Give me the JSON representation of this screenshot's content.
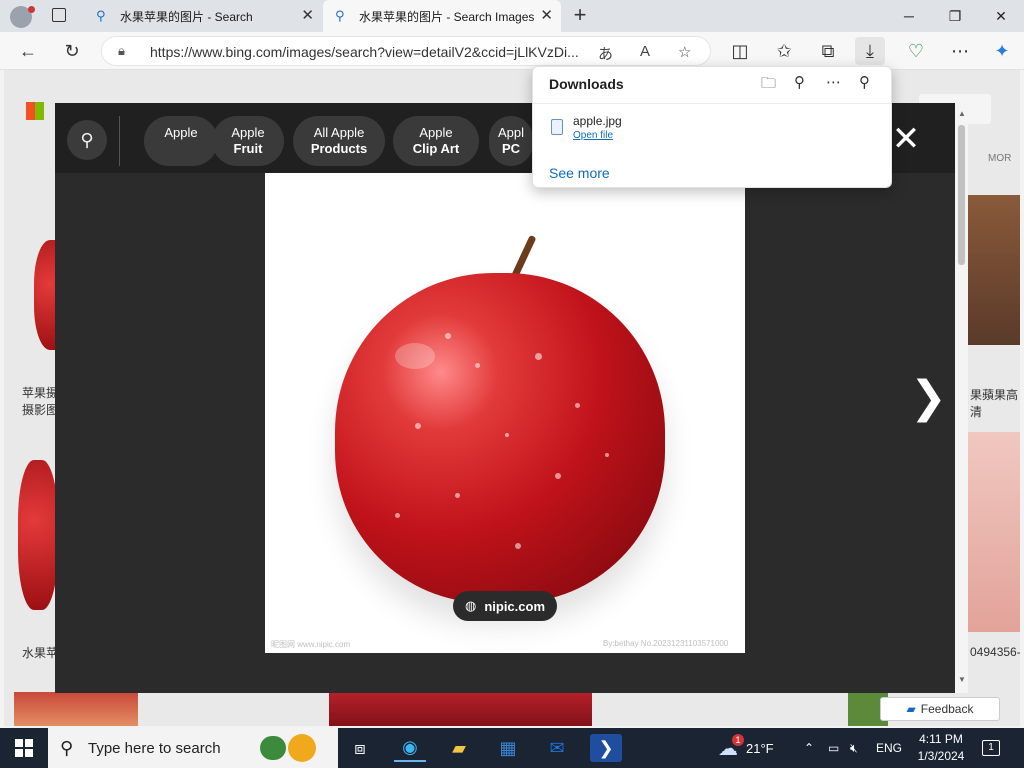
{
  "browser": {
    "tabs": [
      {
        "title": "水果苹果的图片 - Search"
      },
      {
        "title": "水果苹果的图片 - Search Images"
      }
    ],
    "new_tab_symbol": "+",
    "url": "https://www.bing.com/images/search?view=detailV2&ccid=jLlKVzDi...",
    "icons": [
      "tab-actions-icon",
      "back-icon",
      "refresh-icon",
      "lock-icon",
      "translate-icon",
      "read-aloud-icon",
      "favorite-icon",
      "split-screen-icon",
      "favorites-icon",
      "collections-icon",
      "downloads-icon",
      "browser-essentials-icon",
      "more-icon",
      "copilot-icon"
    ]
  },
  "overlay": {
    "chips": [
      {
        "line1": "Apple",
        "line2": ""
      },
      {
        "line1": "Apple",
        "line2": "Fruit"
      },
      {
        "line1": "All Apple",
        "line2": "Products"
      },
      {
        "line1": "Apple",
        "line2": "Clip Art"
      },
      {
        "line1": "Appl",
        "line2": "PC"
      }
    ],
    "source_label": "nipic.com",
    "watermark_left": "昵图网 www.nipic.com",
    "watermark_right": "By:bethay No.20231231103571000",
    "close_symbol": "✕",
    "next_symbol": "❯"
  },
  "background_page": {
    "left_caption_1": "苹果摄",
    "left_caption_2": "摄影图",
    "left_caption_3": "水果苹",
    "right_caption_1": "果蘋果高清",
    "right_caption_2": "0494356-",
    "more_label": "MOR"
  },
  "downloads": {
    "title": "Downloads",
    "file_name": "apple.jpg",
    "open_label": "Open file",
    "see_more": "See more"
  },
  "feedback_label": "Feedback",
  "taskbar": {
    "search_placeholder": "Type here to search",
    "weather_temp": "21°F",
    "weather_badge": "1",
    "language": "ENG",
    "time": "4:11 PM",
    "date": "1/3/2024",
    "notification_count": "1"
  },
  "colors": {
    "accent": "#0f6cbd",
    "overlay_bg": "#2b2b2b",
    "taskbar_bg": "#1b2433"
  }
}
